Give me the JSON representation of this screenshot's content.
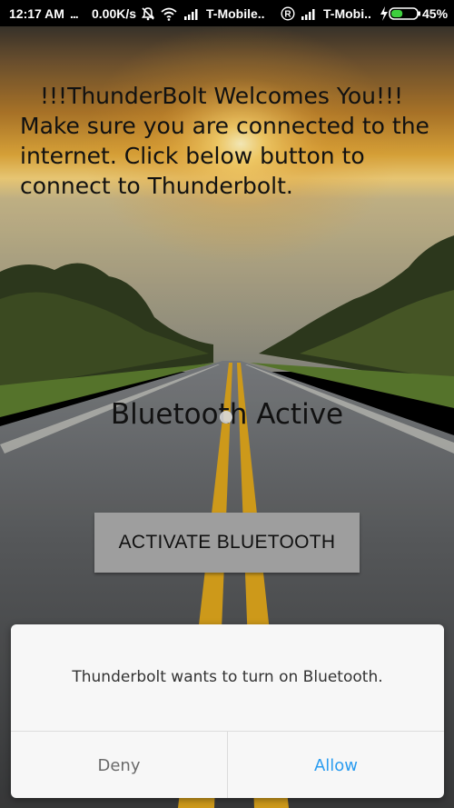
{
  "status_bar": {
    "time": "12:17 AM",
    "dots": "...",
    "network_speed": "0.00K/s",
    "carrier1": "T-Mobile..",
    "carrier2": "T-Mobi..",
    "battery_percent": "45%",
    "icons": [
      "mute-icon",
      "wifi-icon",
      "signal-icon",
      "roaming-icon",
      "charging-icon",
      "battery-icon"
    ],
    "battery_level": 0.45,
    "battery_color": "#3ecf3e"
  },
  "main": {
    "welcome_line1": "!!!ThunderBolt Welcomes You!!!",
    "welcome_line2": "Make sure you are connected to the internet. Click below button to connect to Thunderbolt.",
    "bluetooth_status": "Bluetooth Active",
    "activate_button": "ACTIVATE BLUETOOTH"
  },
  "dialog": {
    "message": "Thunderbolt wants to turn on Bluetooth.",
    "deny_label": "Deny",
    "allow_label": "Allow",
    "allow_color": "#2a9cf0"
  }
}
